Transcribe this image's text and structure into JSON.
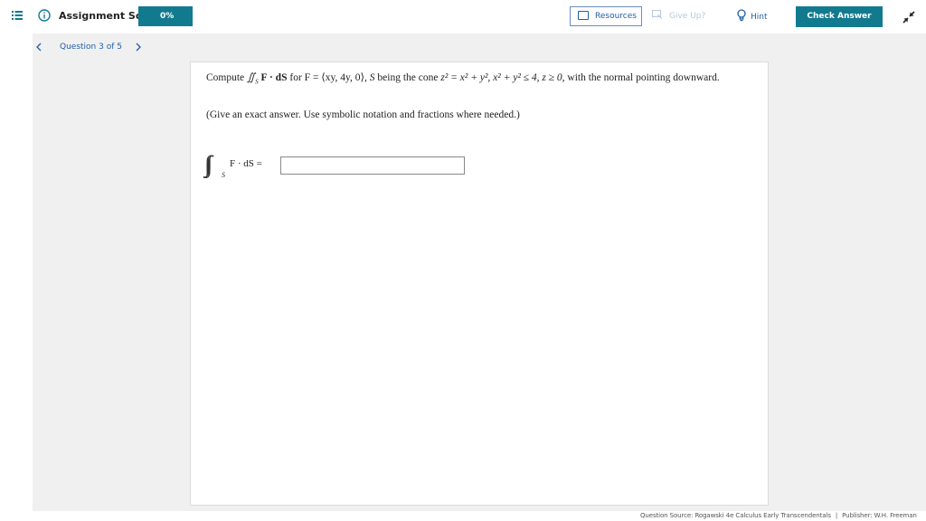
{
  "topbar": {
    "menu_icon": "hamburger-list-icon",
    "info_icon": "info-circle-icon",
    "score_label": "Assignment Score:",
    "score_value": "0%",
    "resources_label": "Resources",
    "giveup_label": "Give Up?",
    "hint_label": "Hint",
    "check_label": "Check Answer",
    "collapse_icon": "collapse-arrows-icon",
    "accent": "#127a8f",
    "link_color": "#1f5fa6"
  },
  "nav": {
    "prev_icon": "chevron-left-icon",
    "question_label": "Question 3 of 5",
    "next_icon": "chevron-right-icon"
  },
  "question": {
    "compute": "Compute",
    "dot_dS": "F · dS",
    "for": "for",
    "F_def": "F = ⟨xy, 4y, 0⟩,",
    "S_being": "being the cone",
    "cone_eq": "z² = x² + y²,",
    "cone_ineq": "x² + y² ≤ 4,",
    "z_cond": "z ≥ 0,",
    "tail": "with the normal pointing downward.",
    "instructions": "(Give an exact answer. Use symbolic notation and fractions where needed.)",
    "answer_label": "F · dS =",
    "answer_value": ""
  },
  "footer": {
    "source": "Question Source: Rogawski 4e Calculus Early Transcendentals",
    "separator": "|",
    "publisher": "Publisher: W.H. Freeman"
  }
}
